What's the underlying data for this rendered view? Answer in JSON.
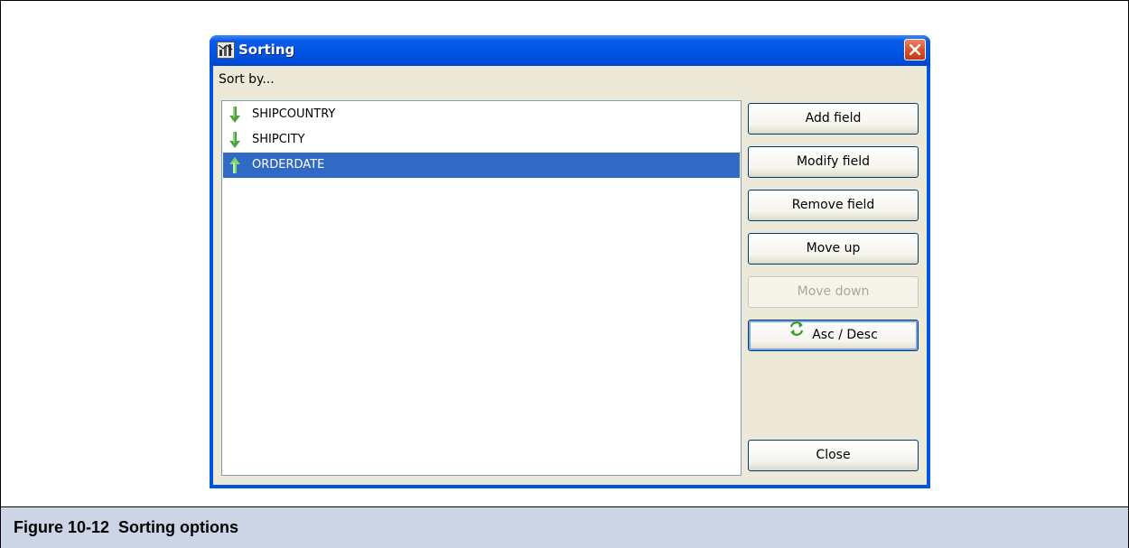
{
  "window": {
    "title": "Sorting",
    "icon": "report-icon"
  },
  "sort_by_label": "Sort by...",
  "sort_fields": [
    {
      "name": "SHIPCOUNTRY",
      "direction": "descending",
      "icon": "arrow-down-green-icon",
      "selected": false
    },
    {
      "name": "SHIPCITY",
      "direction": "descending",
      "icon": "arrow-down-green-icon",
      "selected": false
    },
    {
      "name": "ORDERDATE",
      "direction": "ascending",
      "icon": "arrow-up-green-icon",
      "selected": true
    }
  ],
  "buttons": {
    "add_field": "Add field",
    "modify_field": "Modify field",
    "remove_field": "Remove field",
    "move_up": "Move up",
    "move_down": "Move down",
    "asc_desc": "Asc / Desc",
    "close": "Close"
  },
  "caption": "Figure 10-12  Sorting options",
  "colors": {
    "titlebar": "#0054e3",
    "selection": "#316ac5",
    "client_bg": "#ece9d8",
    "caption_bg": "#cbd5e6"
  }
}
